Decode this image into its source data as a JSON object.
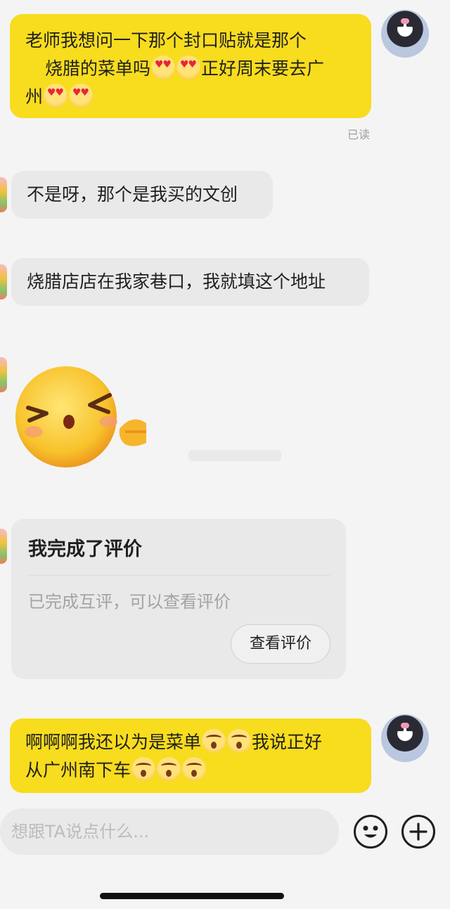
{
  "messages": [
    {
      "from": "me",
      "lines": [
        "老师我想问一下那个封口贴就是那个",
        "烧腊的菜单吗",
        "正好周末要去广",
        "州"
      ],
      "emojis": [
        "heart-eyes-emoji",
        "heart-eyes-emoji",
        "heart-eyes-emoji",
        "heart-eyes-emoji"
      ],
      "status": "已读"
    },
    {
      "from": "other",
      "text": "不是呀，那个是我买的文创"
    },
    {
      "from": "other",
      "text": "烧腊店店在我家巷口，我就填这个地址"
    },
    {
      "from": "other",
      "sticker": "wink-pointing-face-sticker"
    },
    {
      "from": "other",
      "card": {
        "title": "我完成了评价",
        "subtitle": "已完成互评，可以查看评价",
        "button": "查看评价"
      }
    },
    {
      "from": "me",
      "line1_a": "啊啊啊我还以为是菜单",
      "line1_b": "我说正好",
      "line2": "从广州南下车",
      "emojis": [
        "shocked-emoji",
        "shocked-emoji",
        "shocked-emoji",
        "shocked-emoji",
        "shocked-emoji"
      ]
    }
  ],
  "composer": {
    "placeholder": "想跟TA说点什么...",
    "emoji_icon": "smiley-icon",
    "add_icon": "plus-icon"
  },
  "colors": {
    "my_bubble": "#f8dc1e",
    "other_bubble": "#e9e9e9",
    "background": "#f4f4f4"
  }
}
